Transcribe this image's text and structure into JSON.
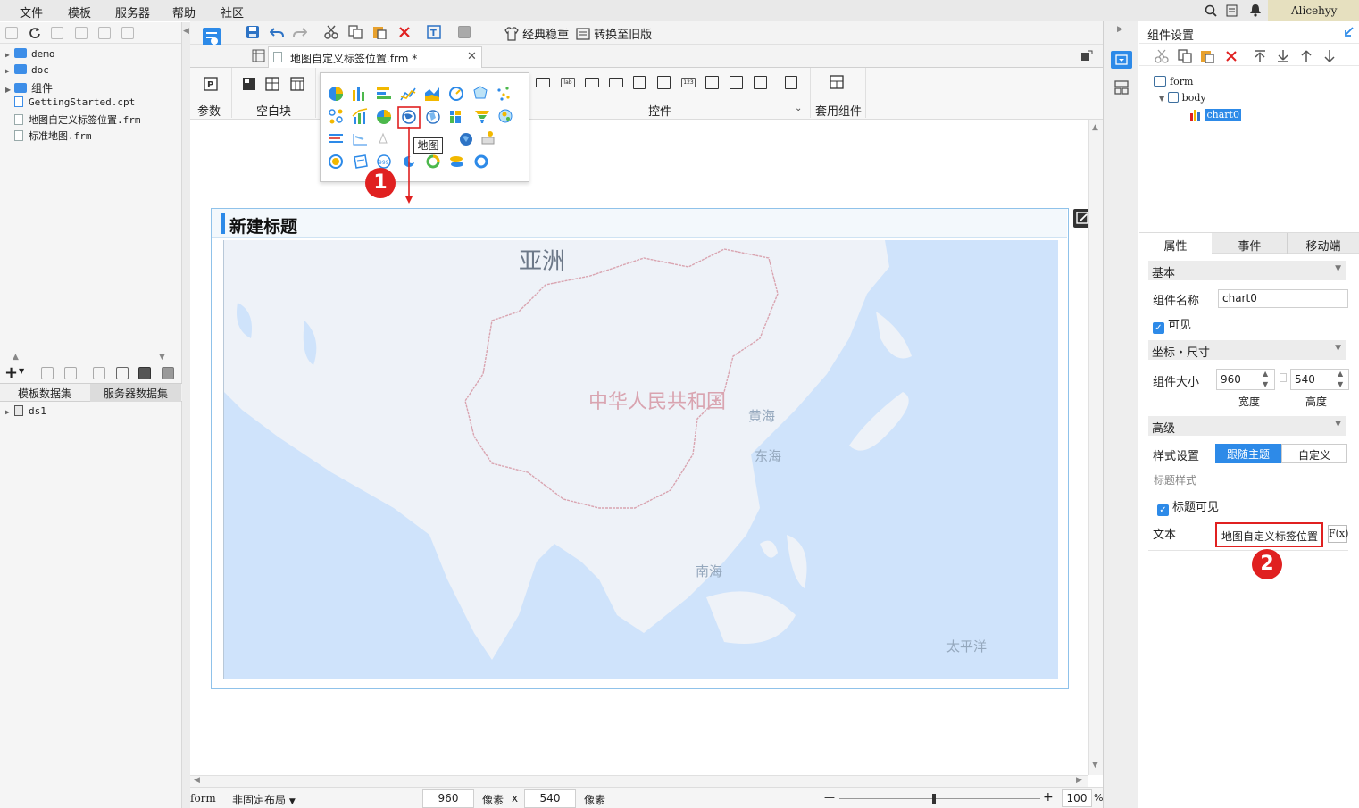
{
  "menubar": {
    "items": [
      "文件",
      "模板",
      "服务器",
      "帮助",
      "社区"
    ],
    "user": "Alicehyy"
  },
  "left_panel": {
    "tree": [
      {
        "label": "demo",
        "type": "folder"
      },
      {
        "label": "doc",
        "type": "folder"
      },
      {
        "label": "组件",
        "type": "folder"
      },
      {
        "label": "GettingStarted.cpt",
        "type": "file"
      },
      {
        "label": "地图自定义标签位置.frm",
        "type": "file"
      },
      {
        "label": "标准地图.frm",
        "type": "file"
      }
    ],
    "dataset_tabs": [
      "模板数据集",
      "服务器数据集"
    ],
    "datasets": [
      "ds1"
    ]
  },
  "toolbar": {
    "classic_label": "经典稳重",
    "convert_label": "转换至旧版"
  },
  "doc_tab": {
    "title": "地图自定义标签位置.frm *"
  },
  "widget_bar": {
    "param_label": "参数",
    "blank_label": "空白块",
    "controls_label": "控件",
    "apply_label": "套用组件"
  },
  "chart_popup": {
    "tooltip": "地图"
  },
  "chart": {
    "title": "新建标题",
    "map_labels": {
      "asia": "亚洲",
      "china": "中华人民共和国",
      "yellow_sea": "黄海",
      "east_sea": "东海",
      "south_sea": "南海",
      "pacific": "太平洋"
    }
  },
  "annotations": {
    "step1": "1",
    "step2": "2"
  },
  "status_bar": {
    "form": "form",
    "layout": "非固定布局",
    "width": "960",
    "unit1": "像素",
    "x": "x",
    "height": "540",
    "unit2": "像素",
    "zoom_minus": "—",
    "zoom_plus": "+",
    "zoom": "100",
    "percent": "%"
  },
  "right_panel": {
    "header": "组件设置",
    "tree": {
      "form": "form",
      "body": "body",
      "chart": "chart0"
    },
    "tabs": [
      "属性",
      "事件",
      "移动端"
    ],
    "basic_section": "基本",
    "name_label": "组件名称",
    "name_value": "chart0",
    "visible_label": "可见",
    "coord_section": "坐标・尺寸",
    "size_label": "组件大小",
    "width_value": "960",
    "height_value": "540",
    "width_label": "宽度",
    "height_label": "高度",
    "advanced_section": "高级",
    "style_label": "样式设置",
    "style_follow": "跟随主题",
    "style_custom": "自定义",
    "title_style_label": "标题样式",
    "title_visible_label": "标题可见",
    "text_label": "文本",
    "text_value": "地图自定义标签位置",
    "fx_label": "F(x)"
  },
  "colors": {
    "accent": "#2d8ae8",
    "annotation_red": "#e02020",
    "map_land": "#eef2f8",
    "map_sea": "#cfe3fb"
  }
}
